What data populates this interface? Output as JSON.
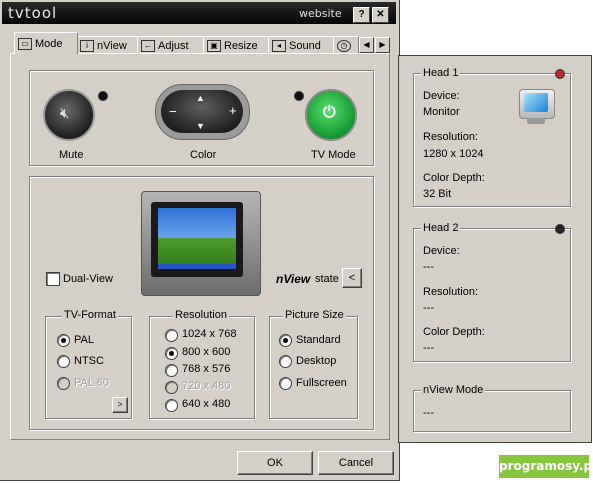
{
  "window": {
    "logo": "tvtool",
    "website_label": "website",
    "help_label": "?",
    "close_label": "✕"
  },
  "tabs": [
    {
      "label": "Mode",
      "icon": "monitor-icon"
    },
    {
      "label": "nView",
      "icon": "info-icon"
    },
    {
      "label": "Adjust",
      "icon": "arrows-icon"
    },
    {
      "label": "Resize",
      "icon": "resize-icon"
    },
    {
      "label": "Sound",
      "icon": "speaker-icon"
    }
  ],
  "controls": {
    "mute_label": "Mute",
    "color_label": "Color",
    "tvmode_label": "TV Mode",
    "minus": "−",
    "plus": "+",
    "up": "▲",
    "down": "▼"
  },
  "display": {
    "dual_view_label": "Dual-View",
    "dual_view_checked": false,
    "nview_word": "nView",
    "state_word": "state",
    "state_button": "<"
  },
  "tv_format": {
    "title": "TV-Format",
    "options": [
      "PAL",
      "NTSC",
      "PAL 60"
    ],
    "selected": "PAL",
    "disabled": [
      "PAL 60"
    ],
    "more_button": ">"
  },
  "resolution": {
    "title": "Resolution",
    "options": [
      "1024 x 768",
      "800 x 600",
      "768 x 576",
      "720 x 480",
      "640 x 480"
    ],
    "selected": "800 x 600",
    "disabled": [
      "720 x 480"
    ]
  },
  "picture_size": {
    "title": "Picture Size",
    "options": [
      "Standard",
      "Desktop",
      "Fullscreen"
    ],
    "selected": "Standard"
  },
  "buttons": {
    "ok": "OK",
    "cancel": "Cancel"
  },
  "head1": {
    "title": "Head 1",
    "led_color": "#c0282a",
    "device_label": "Device:",
    "device_value": "Monitor",
    "resolution_label": "Resolution:",
    "resolution_value": "1280 x 1024",
    "depth_label": "Color Depth:",
    "depth_value": "32 Bit"
  },
  "head2": {
    "title": "Head 2",
    "led_color": "#222222",
    "device_label": "Device:",
    "device_value": "---",
    "resolution_label": "Resolution:",
    "resolution_value": "---",
    "depth_label": "Color Depth:",
    "depth_value": "---"
  },
  "nview_mode": {
    "title": "nView Mode",
    "value": "---"
  },
  "watermark": "programosy.pl",
  "colors": {
    "tvmode_green": "#2db84a",
    "brand_green": "#86c73f"
  }
}
